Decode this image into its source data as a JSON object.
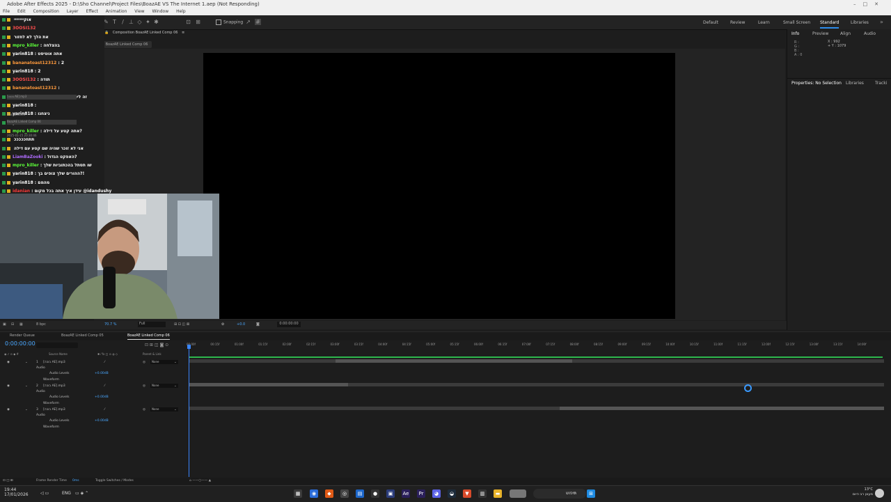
{
  "titlebar": {
    "title": "Adobe After Effects 2025 - D:\\Sho Channel\\Project Files\\BoazAE VS The Internet 1.aep (Not Responding)"
  },
  "menubar": {
    "items": [
      "File",
      "Edit",
      "Composition",
      "Layer",
      "Effect",
      "Animation",
      "View",
      "Window",
      "Help"
    ]
  },
  "toolbar": {
    "snapping_label": "Snapping",
    "workspaces": [
      "Default",
      "Review",
      "Learn",
      "Small Screen",
      "Standard",
      "Libraries"
    ],
    "active_workspace": "Standard"
  },
  "chat": {
    "lines": [
      {
        "user": "",
        "msg": "אוקיייייייי",
        "color": "#ffffff"
      },
      {
        "user": "3OOSI132",
        "msg": "",
        "color": "#ff4d4d"
      },
      {
        "user": "",
        "msg": "את הלך לא לחזור",
        "color": "#ffffff"
      },
      {
        "user": "mpro_killer",
        "msg": ": בהצלחה",
        "color": "#5dff3a"
      },
      {
        "user": "yarin818",
        "msg": ": אתה אוטיסט",
        "color": "#ffffff"
      },
      {
        "user": "bananatoast12312",
        "msg": ": 2",
        "color": "#ff9a3c"
      },
      {
        "user": "yarin818",
        "msg": ": 2",
        "color": "#ffffff"
      },
      {
        "user": "3OOSI132",
        "msg": ": תודה",
        "color": "#ff4d4d"
      },
      {
        "user": "bananatoast12312",
        "msg": ":",
        "color": "#ff9a3c"
      },
      {
        "user": "yarin818",
        "msg": ": זה ליטרלי בשם שלך ממש",
        "color": "#ffffff"
      },
      {
        "user": "yarin818",
        "msg": ":",
        "color": "#ffffff"
      },
      {
        "user": "yarin818",
        "msg": ": ניצחנו",
        "color": "#ffffff"
      },
      {
        "user": "yarin818",
        "msg": ": את",
        "color": "#ffffff"
      },
      {
        "user": "mpro_killer",
        "msg": ": אתה קטע על דילה?",
        "color": "#5dff3a"
      },
      {
        "user": "",
        "msg": "תתחכככככ",
        "color": "#ffffff"
      },
      {
        "user": "",
        "msg": "אני לא זוכר שהיה שם קטע עם דילה",
        "color": "#ffffff"
      },
      {
        "user": "LiamBaZooki",
        "msg": ": האפקט הגדול?",
        "color": "#b06cff"
      },
      {
        "user": "mpro_killer",
        "msg": ": שו תסתל בהכתוביות שלך",
        "color": "#5dff3a"
      },
      {
        "user": "yarin818",
        "msg": ": ההורים שלך צופים בך?!",
        "color": "#ffffff"
      },
      {
        "user": "yarin818",
        "msg": ": מהמם",
        "color": "#ffffff"
      },
      {
        "user": "idanian",
        "msg": ": עידן איך אתה בכל מקום @idandushy",
        "color": "#ff3a3a"
      }
    ]
  },
  "project": {
    "rows": [
      "[בובה AE].mp3",
      "Main Discord",
      "BoazAE Linked Comp 06"
    ],
    "timestamp": "2025-01-15 20:30:46"
  },
  "composition": {
    "header": "Composition BoazAE Linked Comp 06",
    "tab": "BoazAE Linked Comp 06",
    "bar": {
      "bpc": "8 bpc",
      "zoom": "70.7 %",
      "resolution": "Full",
      "exposure": "+0.0",
      "timecode": "0:00:00:00"
    }
  },
  "rightpanel": {
    "tabs": [
      "Info",
      "Preview",
      "Align",
      "Audio"
    ],
    "info_rgb": [
      "R :",
      "G :",
      "B :",
      "A : 0"
    ],
    "x": "X : 992",
    "y": "+ Y : 1079",
    "props_tabs": [
      "Properties: No Selection",
      "Libraries",
      "Tracki"
    ]
  },
  "timeline": {
    "tabs": [
      "Render Queue",
      "BoazAE Linked Comp 05",
      "BoazAE Linked Comp 06"
    ],
    "timecode": "0:00:00:00",
    "ticks": [
      "00:00f",
      "00:15f",
      "01:00f",
      "01:15f",
      "02:00f",
      "02:15f",
      "03:00f",
      "03:15f",
      "04:00f",
      "04:15f",
      "05:00f",
      "05:15f",
      "06:00f",
      "06:15f",
      "07:00f",
      "07:15f",
      "08:00f",
      "08:15f",
      "09:00f",
      "09:15f",
      "10:00f",
      "10:15f",
      "11:00f",
      "11:15f",
      "12:00f",
      "12:15f",
      "13:00f",
      "13:15f",
      "14:00f"
    ],
    "col_source": "Source Name",
    "col_parent": "Parent & Link",
    "layers": [
      {
        "num": "1",
        "name": "[בובה AE].mp3",
        "mode": "None",
        "audio": "Audio",
        "levels": "Audio Levels",
        "levels_val": "+0.00dB",
        "waveform": "Waveform"
      },
      {
        "num": "2",
        "name": "[בובה AE].mp3",
        "mode": "None",
        "audio": "Audio",
        "levels": "Audio Levels",
        "levels_val": "+0.00dB",
        "waveform": "Waveform"
      },
      {
        "num": "3",
        "name": "[בובה AE].mp3",
        "mode": "None",
        "audio": "Audio",
        "levels": "Audio Levels",
        "levels_val": "+0.00dB",
        "waveform": "Waveform"
      }
    ],
    "frame_render_label": "Frame Render Time",
    "frame_render_val": "0ms",
    "toggle_label": "Toggle Switches / Modes"
  },
  "taskbar": {
    "time": "19:44",
    "date": "17/01/2026",
    "lang": "ENG",
    "search_placeholder": "חיפוש",
    "weather_temp": "13°C",
    "weather_desc": "מעונן רב היום"
  }
}
